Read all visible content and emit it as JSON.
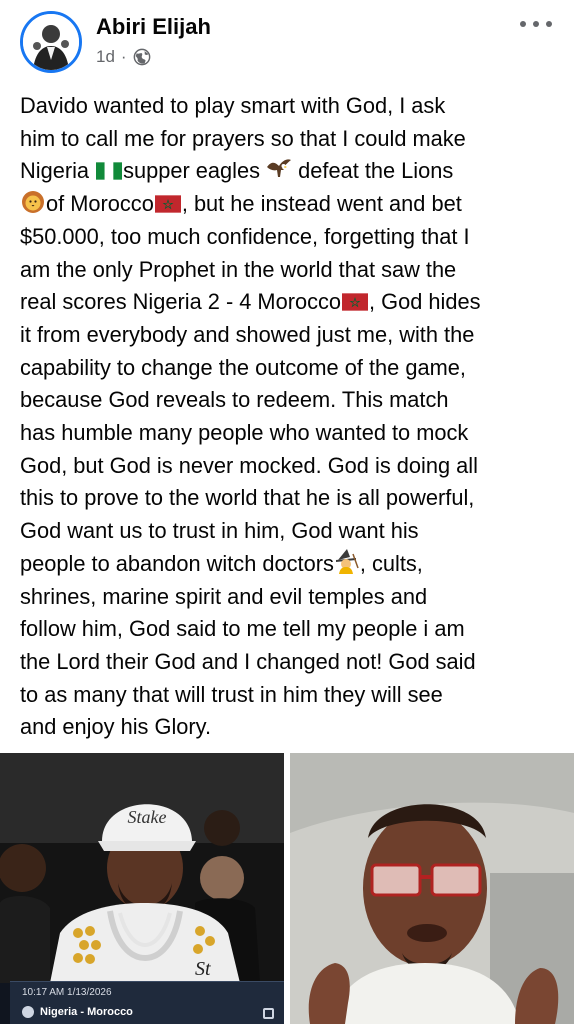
{
  "post": {
    "author": "Abiri Elijah",
    "time": "1d",
    "separator": "·",
    "text_lines": [
      "Davido wanted to play smart with God, I ask",
      "him to call me for prayers so that I could make",
      "Nigeria ",
      "supper eagles ",
      " defeat the Lions",
      "of Morocco",
      ", but he instead went and bet",
      "$50.000, too much confidence, forgetting that I",
      "am the only Prophet in the world that saw the",
      "real scores Nigeria 2 - 4 Morocco",
      ", God hides",
      "it from everybody and showed just me, with the",
      "capability to change the outcome of the game,",
      "because God reveals to redeem. This match",
      "has humble many people who wanted to mock",
      "God, but God is never mocked. God is doing all",
      "this to prove to the world that he is all powerful,",
      "God want us to trust in him, God want his",
      "people to abandon witch doctors",
      ", cults,",
      "shrines, marine spirit and evil temples and",
      "follow him, God said to me tell my people i am",
      "the Lord their God and I changed not! God said",
      "to as many that will trust in him they will see",
      "and enjoy his Glory."
    ]
  },
  "images": {
    "left": {
      "cap_text": "Stake",
      "shirt_text": "St",
      "bet_time": "10:17 AM 1/13/2026",
      "bet_match": "Nigeria - Morocco"
    }
  },
  "icons": {
    "privacy": "globe-icon",
    "more": "more-options-icon",
    "eagle": "eagle-emoji",
    "lion": "lion-emoji",
    "witch": "witch-emoji",
    "flag_ng": "nigeria-flag",
    "flag_ma": "morocco-flag"
  },
  "colors": {
    "accent": "#1877f2",
    "meta": "#65676b",
    "text": "#050505"
  }
}
